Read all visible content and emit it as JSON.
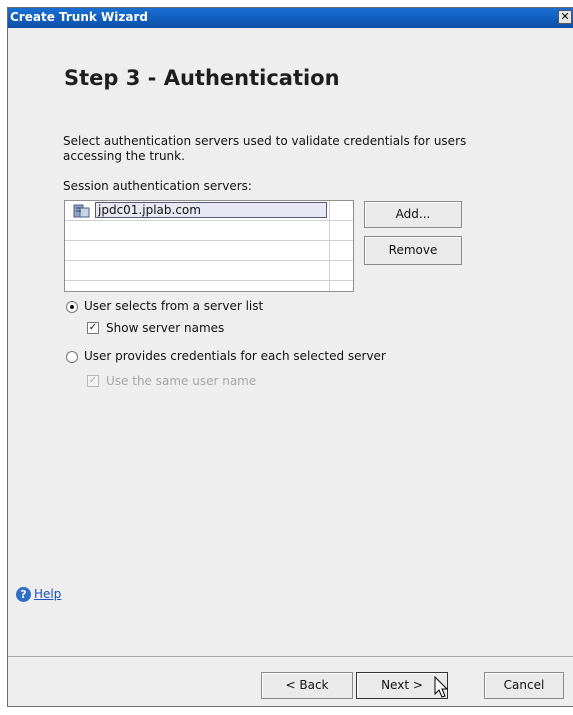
{
  "window": {
    "title": "Create Trunk Wizard",
    "close_glyph": "✕"
  },
  "page": {
    "step_title": "Step 3 - Authentication",
    "description": "Select authentication servers used to validate credentials for users accessing the trunk.",
    "servers_label": "Session authentication servers:"
  },
  "servers": [
    {
      "name": "jpdc01.jplab.com",
      "icon": "server-icon"
    }
  ],
  "buttons": {
    "add": "Add...",
    "remove": "Remove"
  },
  "options": {
    "server_list": {
      "label": "User selects from a server list",
      "selected": true
    },
    "show_names": {
      "label": "Show server names",
      "checked": true,
      "enabled": true
    },
    "provide_credentials": {
      "label": "User provides credentials for each selected server",
      "selected": false
    },
    "same_user": {
      "label": "Use the same user name",
      "checked": true,
      "enabled": false
    }
  },
  "help": {
    "label": "Help",
    "icon": "help-icon"
  },
  "footer": {
    "back": "< Back",
    "next": "Next >",
    "cancel": "Cancel"
  },
  "colors": {
    "titlebar": "#0b4fa8",
    "window_bg": "#eeeeee",
    "link": "#1c4fc9"
  }
}
